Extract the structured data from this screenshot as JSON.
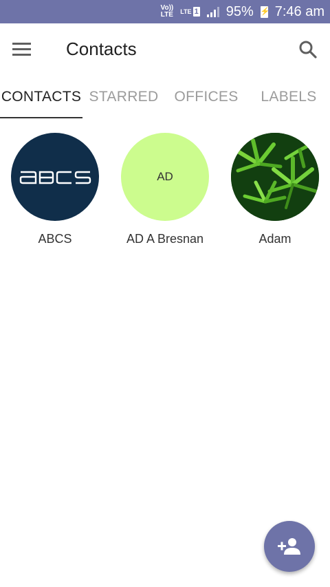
{
  "status_bar": {
    "volte": "Vo))",
    "volte_sub": "LTE",
    "lte": "LTE",
    "sim_slot": "1",
    "battery_percent": "95%",
    "time": "7:46 am"
  },
  "app_bar": {
    "title": "Contacts",
    "menu_icon": "menu-icon",
    "search_icon": "search-icon"
  },
  "tabs": [
    {
      "label": "CONTACTS",
      "active": true
    },
    {
      "label": "STARRED",
      "active": false
    },
    {
      "label": "OFFICES",
      "active": false
    },
    {
      "label": "LABELS",
      "active": false
    }
  ],
  "contacts": [
    {
      "name": "ABCS",
      "avatar_type": "logo",
      "avatar_text": "ABCS",
      "avatar_color": "#102e4a"
    },
    {
      "name": "AD A Bresnan",
      "avatar_type": "initials",
      "avatar_text": "AD",
      "avatar_color": "#ccfc8e"
    },
    {
      "name": "Adam",
      "avatar_type": "photo",
      "avatar_color": "#0f3d0e"
    }
  ],
  "fab": {
    "icon": "add-person-icon",
    "color": "#6e73a8"
  },
  "colors": {
    "accent": "#6e73a8"
  }
}
